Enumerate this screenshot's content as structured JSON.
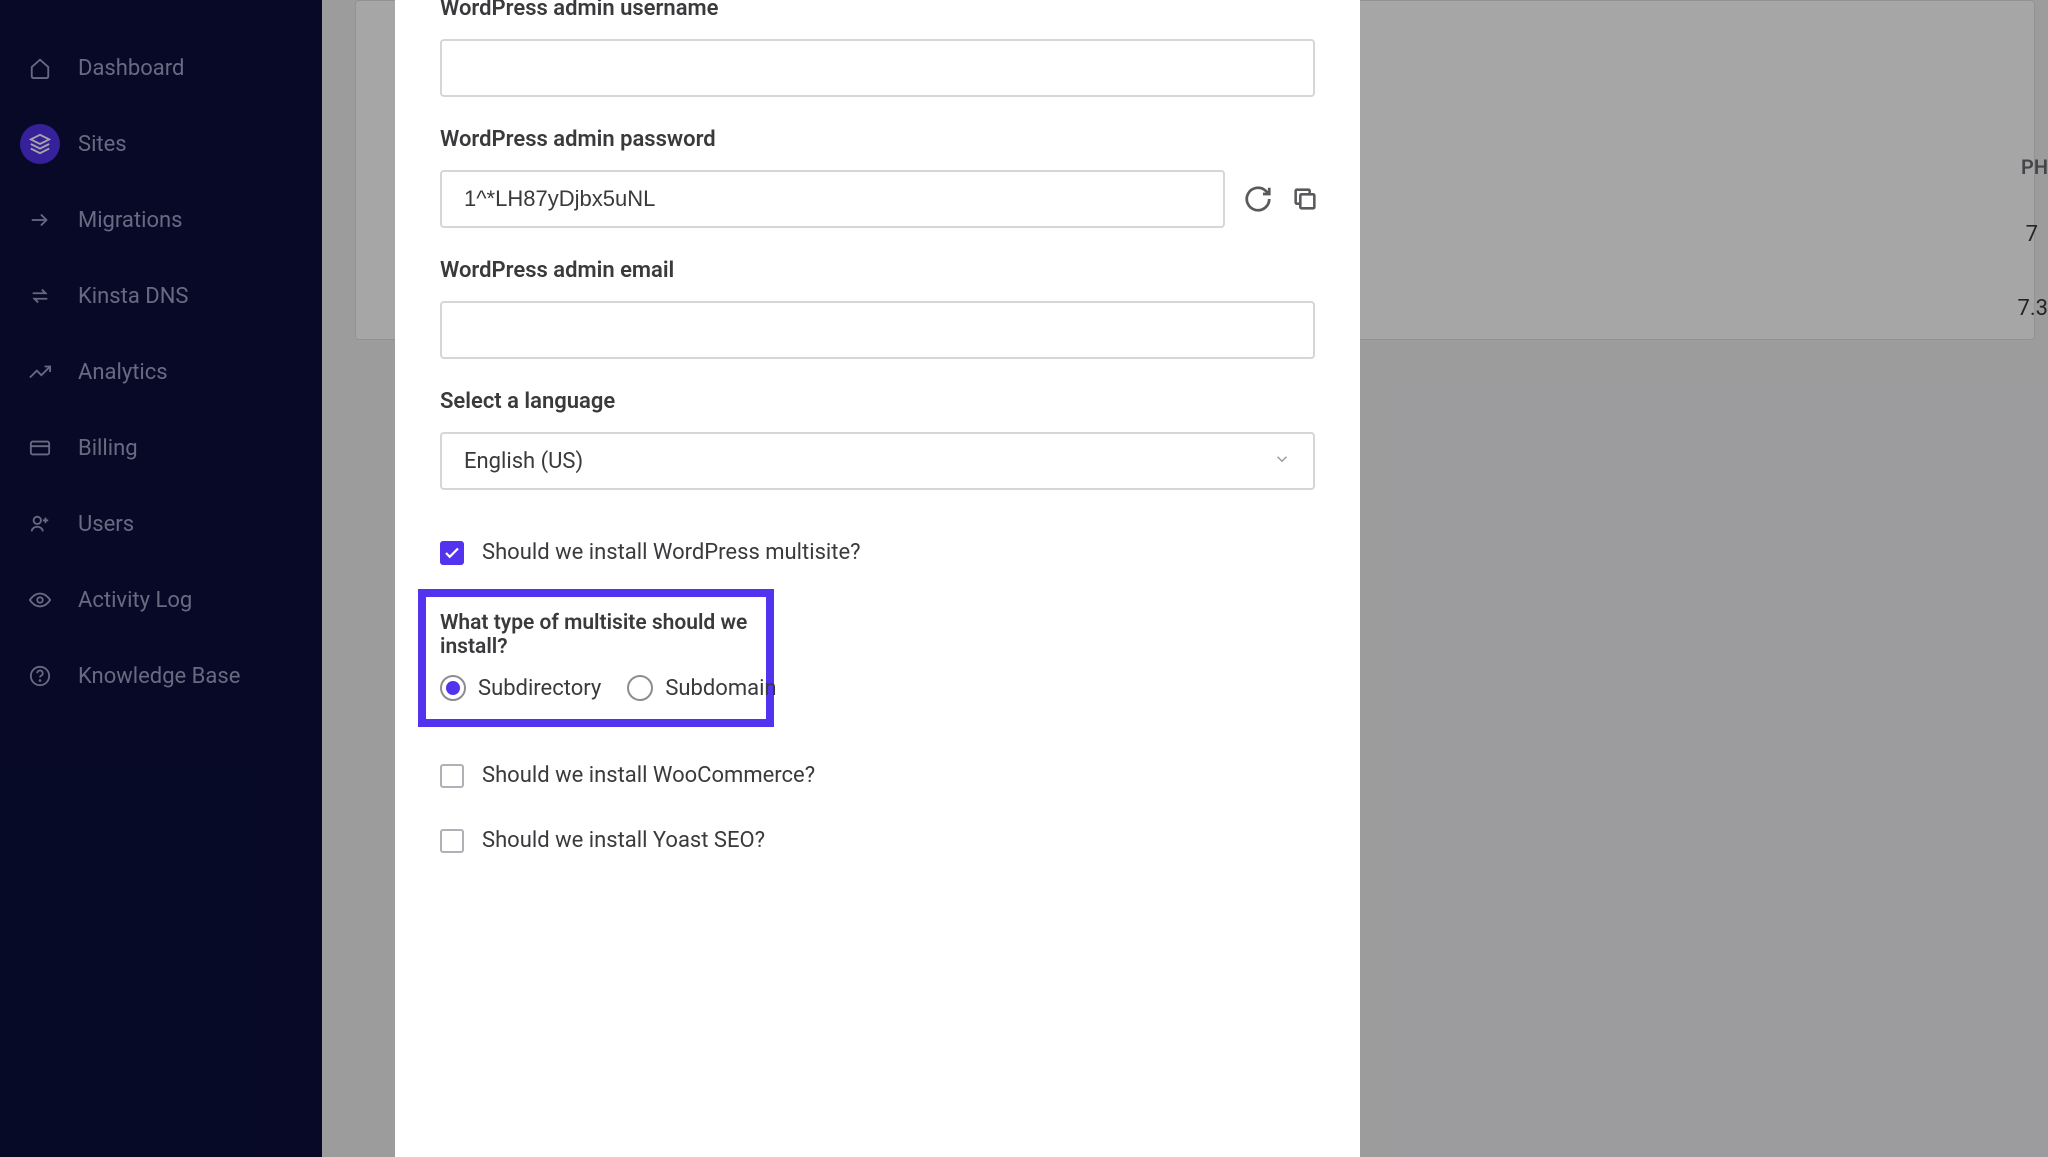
{
  "sidebar": {
    "items": [
      {
        "label": "Dashboard",
        "icon": "home"
      },
      {
        "label": "Sites",
        "icon": "layers",
        "active": true
      },
      {
        "label": "Migrations",
        "icon": "arrows"
      },
      {
        "label": "Kinsta DNS",
        "icon": "transfer"
      },
      {
        "label": "Analytics",
        "icon": "trending"
      },
      {
        "label": "Billing",
        "icon": "card"
      },
      {
        "label": "Users",
        "icon": "users"
      },
      {
        "label": "Activity Log",
        "icon": "eye"
      },
      {
        "label": "Knowledge Base",
        "icon": "help"
      }
    ]
  },
  "form": {
    "username_label": "WordPress admin username",
    "username_value": "",
    "password_label": "WordPress admin password",
    "password_value": "1^*LH87yDjbx5uNL",
    "email_label": "WordPress admin email",
    "email_value": "",
    "language_label": "Select a language",
    "language_value": "English (US)",
    "multisite_checkbox_label": "Should we install WordPress multisite?",
    "multisite_checked": true,
    "multisite_type_label": "What type of multisite should we install?",
    "multisite_radio_subdirectory": "Subdirectory",
    "multisite_radio_subdomain": "Subdomain",
    "woocommerce_label": "Should we install WooCommerce?",
    "woocommerce_checked": false,
    "yoast_label": "Should we install Yoast SEO?",
    "yoast_checked": false
  },
  "bg": {
    "php_header": "PH",
    "row1_val": "7",
    "row2_val": "7.3"
  }
}
